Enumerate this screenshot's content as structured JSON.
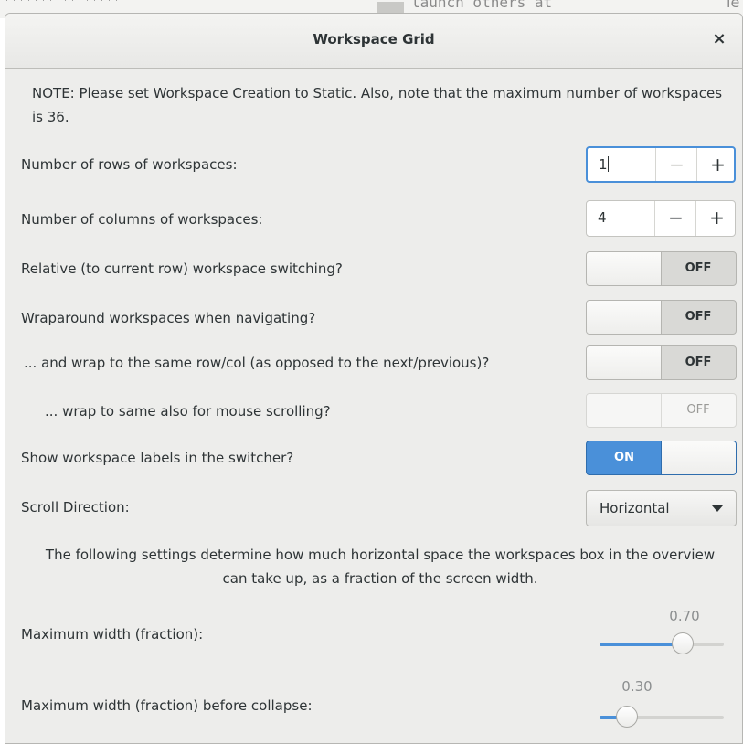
{
  "background": {
    "stars": "****************",
    "text_left": "launch others at",
    "text_right": "le"
  },
  "dialog": {
    "title": "Workspace Grid",
    "close_glyph": "×"
  },
  "note": "NOTE: Please set Workspace Creation to Static. Also, note that the maximum number of workspaces is 36.",
  "rows": {
    "label": "Number of rows of workspaces:",
    "value": "1",
    "minus": "−",
    "plus": "+",
    "minus_disabled": true
  },
  "columns": {
    "label": "Number of columns of workspaces:",
    "value": "4",
    "minus": "−",
    "plus": "+",
    "minus_disabled": false
  },
  "toggles": [
    {
      "label": "Relative (to current row) workspace switching?",
      "state": "OFF",
      "on": false,
      "enabled": true
    },
    {
      "label": "Wraparound workspaces when navigating?",
      "state": "OFF",
      "on": false,
      "enabled": true
    },
    {
      "label": "... and wrap to the same row/col (as opposed to the next/previous)?",
      "state": "OFF",
      "on": false,
      "enabled": true
    },
    {
      "label": "... wrap to same also for mouse scrolling?",
      "state": "OFF",
      "on": false,
      "enabled": false
    },
    {
      "label": "Show workspace labels in the switcher?",
      "state": "ON",
      "on": true,
      "enabled": true
    }
  ],
  "scroll_direction": {
    "label": "Scroll Direction:",
    "value": "Horizontal"
  },
  "info": "The following settings determine how much horizontal space the workspaces box in the overview can take up, as a fraction of the screen width.",
  "sliders": [
    {
      "label": "Maximum width (fraction):",
      "value_text": "0.70",
      "value": 0.7
    },
    {
      "label": "Maximum width (fraction) before collapse:",
      "value_text": "0.30",
      "value": 0.3
    }
  ],
  "colors": {
    "accent": "#4a90d9",
    "dialog_bg": "#ededeb"
  }
}
